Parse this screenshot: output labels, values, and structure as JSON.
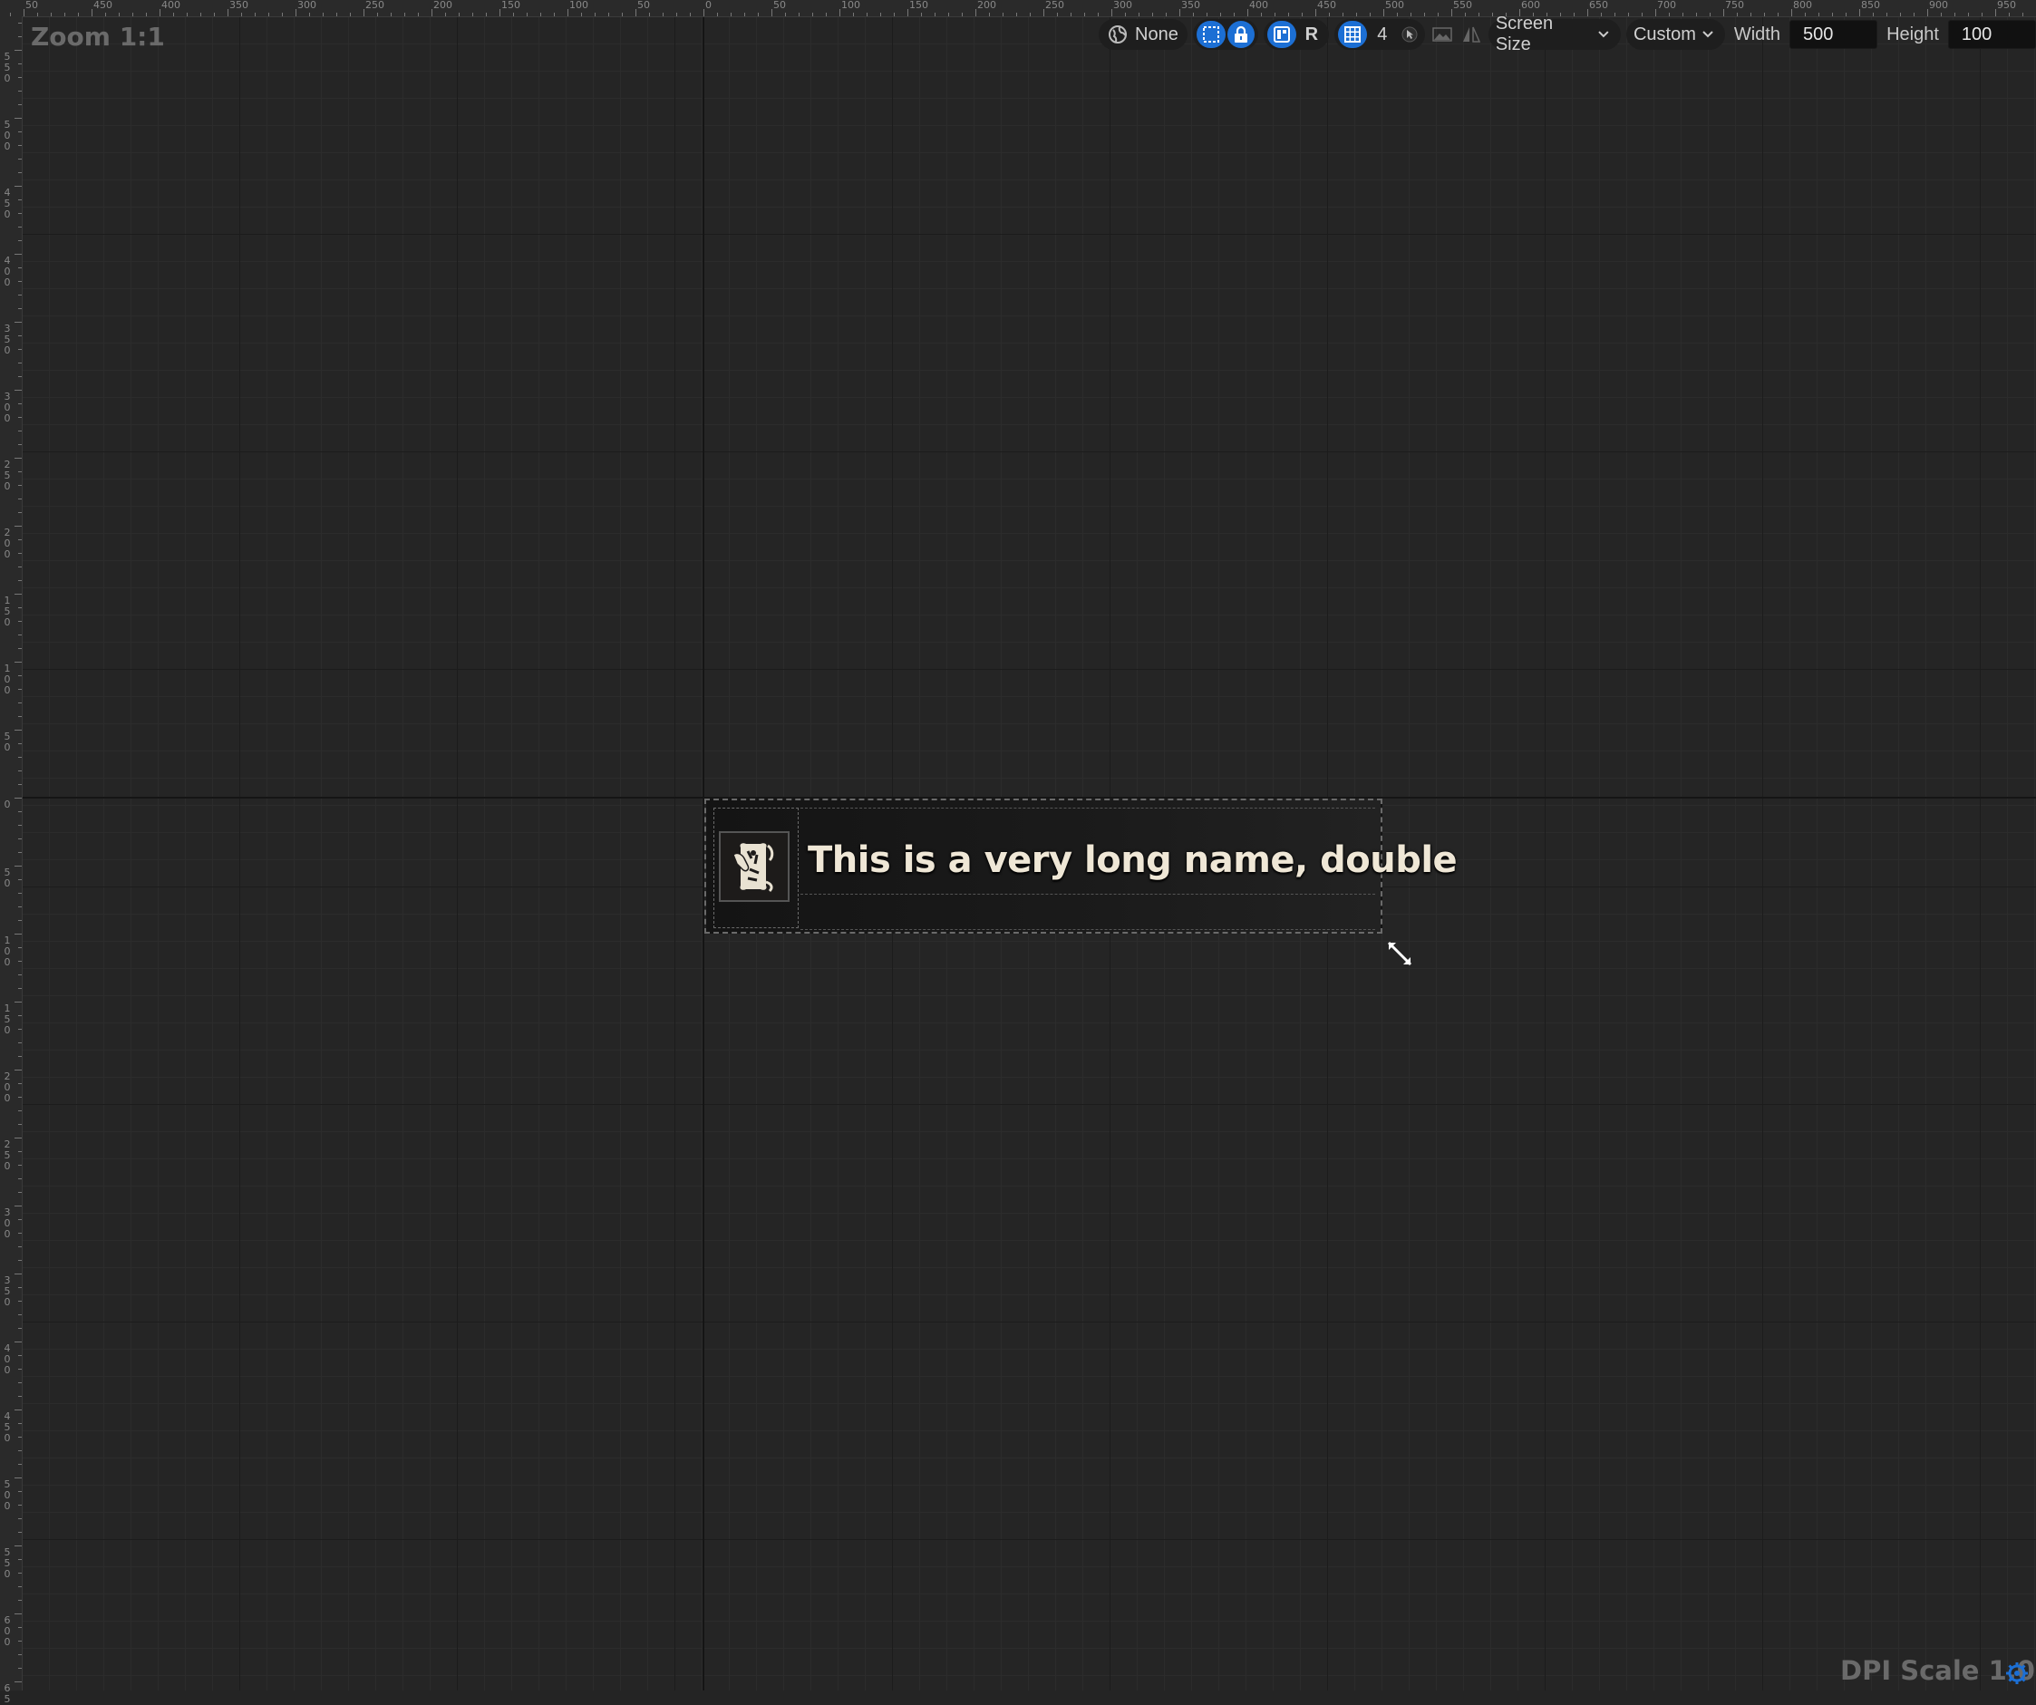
{
  "canvas": {
    "zoom_label": "Zoom 1:1",
    "dpi_label": "DPI Scale 1.0"
  },
  "ruler_top": {
    "labels": [
      "50",
      "450",
      "400",
      "350",
      "300",
      "250",
      "200",
      "150",
      "100",
      "50",
      "0",
      "50",
      "100",
      "150",
      "200",
      "250",
      "300",
      "350",
      "400",
      "450",
      "500",
      "550",
      "600",
      "650",
      "700",
      "750",
      "800",
      "850",
      "900",
      "950"
    ]
  },
  "ruler_left": {
    "labels": [
      "550",
      "500",
      "450",
      "400",
      "350",
      "300",
      "250",
      "200",
      "150",
      "100",
      "50",
      "0",
      "50",
      "100",
      "150",
      "200",
      "250",
      "300",
      "350",
      "400",
      "450",
      "500",
      "550",
      "600",
      "65"
    ]
  },
  "toolbar": {
    "culture_icon": "globe-icon",
    "culture_value": "None",
    "marquee_icon": "marquee-select-icon",
    "lock_icon": "lock-icon",
    "layout_icon": "layout-icon",
    "respect_locks_label": "R",
    "grid_icon": "grid-icon",
    "grid_size": "4",
    "cursor_icon": "cursor-icon",
    "background_icon": "landscape-icon",
    "flip_icon": "flip-icon",
    "screen_size_label": "Screen Size",
    "fill_mode_label": "Custom",
    "width_label": "Width",
    "width_value": "500",
    "height_label": "Height",
    "height_value": "100"
  },
  "widget": {
    "icon": "ghost-banner-icon",
    "name_text": "This is a very long name, double"
  },
  "colors": {
    "accent": "#1c6fd4",
    "canvas_bg": "#252525",
    "name_text": "#efe7d6"
  }
}
